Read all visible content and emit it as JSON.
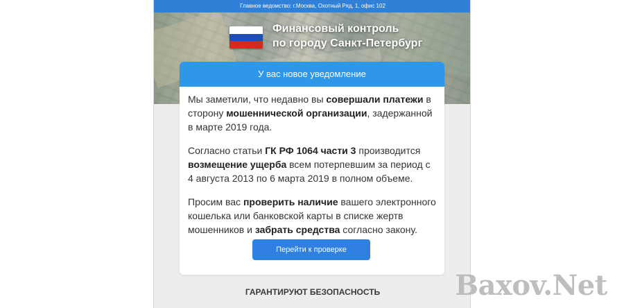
{
  "topbar": {
    "text": "Главное ведомство: г.Москва, Охотный Ряд, 1, офис 102"
  },
  "hero": {
    "title_line1": "Финансовый контроль",
    "title_line2": "по городу Санкт-Петербург",
    "flag_colors": [
      "#ffffff",
      "#1f4fb6",
      "#d52b1e"
    ]
  },
  "notice": {
    "header": "У вас новое уведомление",
    "paragraphs": [
      [
        {
          "t": "Мы заметили, что недавно вы ",
          "b": false
        },
        {
          "t": "совершали платежи",
          "b": true
        },
        {
          "t": " в сторону ",
          "b": false
        },
        {
          "t": "мошеннической организации",
          "b": true
        },
        {
          "t": ", задержанной в марте 2019 года.",
          "b": false
        }
      ],
      [
        {
          "t": "Согласно статьи ",
          "b": false
        },
        {
          "t": "ГК РФ 1064 части 3",
          "b": true
        },
        {
          "t": " производится ",
          "b": false
        },
        {
          "t": "возмещение ущерба",
          "b": true
        },
        {
          "t": " всем потерпевшим за период с 4 августа 2013 по 6 марта 2019 в полном объеме.",
          "b": false
        }
      ],
      [
        {
          "t": "Просим вас ",
          "b": false
        },
        {
          "t": "проверить наличие",
          "b": true
        },
        {
          "t": " вашего электронного кошелька или банковской карты в списке жертв мошенников и ",
          "b": false
        },
        {
          "t": "забрать средства",
          "b": true
        },
        {
          "t": " согласно закону.",
          "b": false
        }
      ]
    ],
    "button_label": "Перейти к проверке"
  },
  "footer": {
    "guarantee": "ГАРАНТИРУЮТ БЕЗОПАСНОСТЬ"
  },
  "watermark": {
    "text": "Baxov.Net"
  },
  "colors": {
    "accent": "#2f80e0",
    "header_blue": "#2f97e8",
    "topbar_blue": "#2f80d6"
  }
}
